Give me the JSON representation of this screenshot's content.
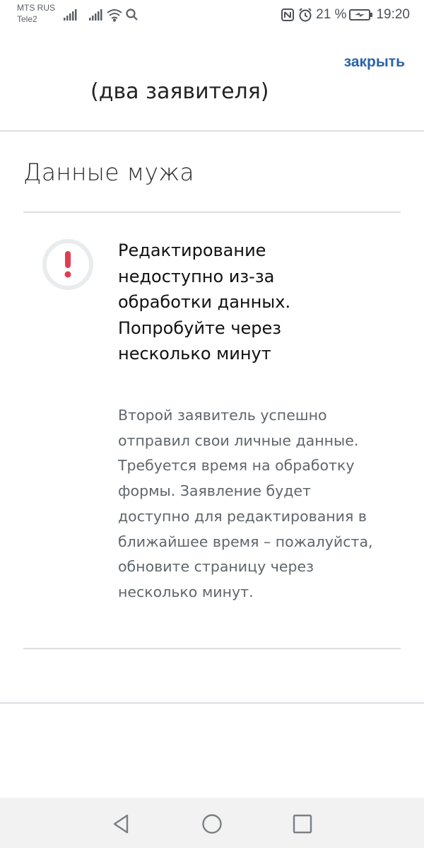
{
  "status_bar": {
    "carrier_1": "MTS RUS",
    "carrier_2": "Tele2",
    "battery_percent": "21 %",
    "time": "19:20",
    "icons": [
      "signal-icon",
      "signal-icon",
      "wifi-icon",
      "search-icon",
      "nfc-icon",
      "alarm-icon",
      "battery-charging-icon"
    ]
  },
  "header": {
    "close_label": "закрыть",
    "clipped_title": "(два заявителя)"
  },
  "section": {
    "heading": "Данные мужа"
  },
  "notice": {
    "icon": "exclamation-icon",
    "title": "Редактирование недоступно из-за обработки данных. Попробуйте через несколько минут",
    "body": "Второй заявитель успешно отправил свои личные данные. Требуется время на обработку формы. Заявление будет доступно для редактирования в ближайшее время – пожалуйста, обновите страницу через несколько минут."
  },
  "colors": {
    "accent_link": "#2a63ab",
    "warning_red": "#e03d52",
    "ring_gray": "#e9ecee"
  },
  "nav_bar": {
    "buttons": [
      "back-icon",
      "home-icon",
      "recents-icon"
    ]
  }
}
